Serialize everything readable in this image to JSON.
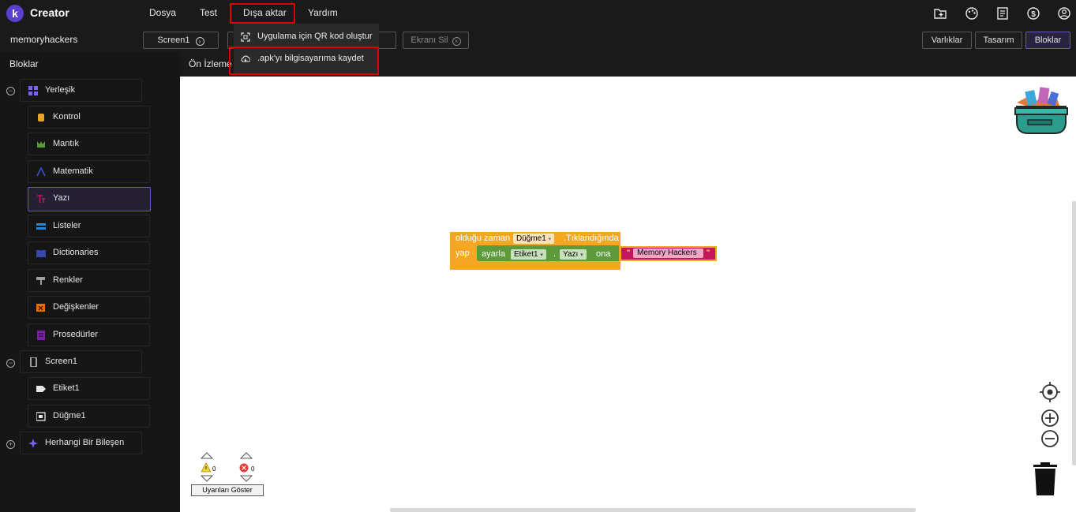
{
  "app": {
    "logo_letter": "k",
    "title": "Creator"
  },
  "menu": {
    "file": "Dosya",
    "test": "Test",
    "export": "Dışa aktar",
    "help": "Yardım"
  },
  "top_icons": [
    "folder-plus-icon",
    "palette-icon",
    "notes-icon",
    "dollar-icon",
    "account-icon"
  ],
  "toolbar": {
    "project_name": "memoryhackers",
    "screen_select": "Screen1",
    "delete_screen": "Ekranı Sil",
    "assets": "Varlıklar",
    "design": "Tasarım",
    "blocks": "Bloklar"
  },
  "export_menu": {
    "qr_item": "Uygulama için QR kod oluştur",
    "apk_item": ".apk'yı bilgisayarıma kaydet"
  },
  "left_panel": {
    "heading": "Bloklar",
    "builtin": "Yerleşik",
    "items": [
      {
        "label": "Kontrol",
        "color": "#e8a42a"
      },
      {
        "label": "Mantık",
        "color": "#5c9a3a"
      },
      {
        "label": "Matematik",
        "color": "#3f4ec9"
      },
      {
        "label": "Yazı",
        "color": "#c2185b"
      },
      {
        "label": "Listeler",
        "color": "#1e88e5"
      },
      {
        "label": "Dictionaries",
        "color": "#3949ab"
      },
      {
        "label": "Renkler",
        "color": "#9e9e9e"
      },
      {
        "label": "Değişkenler",
        "color": "#ef6c00"
      },
      {
        "label": "Prosedürler",
        "color": "#7b1fa2"
      }
    ],
    "screen": "Screen1",
    "components": [
      "Etiket1",
      "Düğme1"
    ],
    "any_component": "Herhangi Bir Bileşen"
  },
  "preview_tab": "Ön İzleme",
  "blocks": {
    "event_prefix": "olduğu zaman",
    "event_component": "Düğme1",
    "event_name": ".Tıklandığında",
    "do_label": "yap",
    "set_label": "ayarla",
    "set_component": "Etiket1",
    "dot": ".",
    "set_property": "Yazı",
    "to_label": "ona",
    "quote": "\"",
    "text_value": "Memory Hackers"
  },
  "warnings": {
    "warning_count": "0",
    "error_count": "0",
    "show_warnings": "Uyarıları Göster"
  },
  "colors": {
    "accent": "#5b3fd0",
    "highlight": "#e00000",
    "event_block": "#f5a623",
    "set_block": "#5c9a3a",
    "text_block": "#c2185b"
  }
}
